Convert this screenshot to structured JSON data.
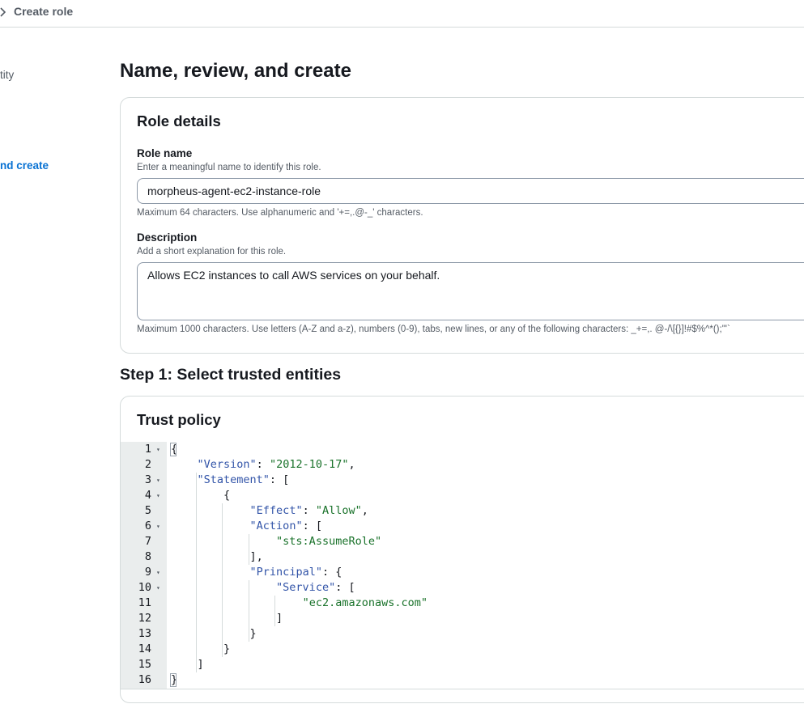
{
  "breadcrumb": {
    "current": "Create role"
  },
  "sidebar": {
    "items": [
      {
        "label": "tity"
      },
      {
        "label": "nd create"
      }
    ]
  },
  "page": {
    "title": "Name, review, and create"
  },
  "role_details": {
    "title": "Role details",
    "role_name": {
      "label": "Role name",
      "hint": "Enter a meaningful name to identify this role.",
      "value": "morpheus-agent-ec2-instance-role",
      "constraint": "Maximum 64 characters. Use alphanumeric and '+=,.@-_' characters."
    },
    "description": {
      "label": "Description",
      "hint": "Add a short explanation for this role.",
      "value": "Allows EC2 instances to call AWS services on your behalf.",
      "constraint": "Maximum 1000 characters. Use letters (A-Z and a-z), numbers (0-9), tabs, new lines, or any of the following characters: _+=,. @-/\\[{}]!#$%^*();\"'`"
    }
  },
  "step1": {
    "title": "Step 1: Select trusted entities"
  },
  "trust_policy": {
    "title": "Trust policy",
    "lines": [
      {
        "n": "1",
        "text": "{"
      },
      {
        "n": "2",
        "text": "    \"Version\": \"2012-10-17\","
      },
      {
        "n": "3",
        "text": "    \"Statement\": ["
      },
      {
        "n": "4",
        "text": "        {"
      },
      {
        "n": "5",
        "text": "            \"Effect\": \"Allow\","
      },
      {
        "n": "6",
        "text": "            \"Action\": ["
      },
      {
        "n": "7",
        "text": "                \"sts:AssumeRole\""
      },
      {
        "n": "8",
        "text": "            ],"
      },
      {
        "n": "9",
        "text": "            \"Principal\": {"
      },
      {
        "n": "10",
        "text": "                \"Service\": ["
      },
      {
        "n": "11",
        "text": "                    \"ec2.amazonaws.com\""
      },
      {
        "n": "12",
        "text": "                ]"
      },
      {
        "n": "13",
        "text": "            }"
      },
      {
        "n": "14",
        "text": "        }"
      },
      {
        "n": "15",
        "text": "    ]"
      },
      {
        "n": "16",
        "text": "}"
      }
    ]
  },
  "colors": {
    "link": "#0972d3",
    "json_key": "#3254a8",
    "json_string": "#19722a",
    "gutter": "#eaeded",
    "border": "#d5dbdb"
  }
}
